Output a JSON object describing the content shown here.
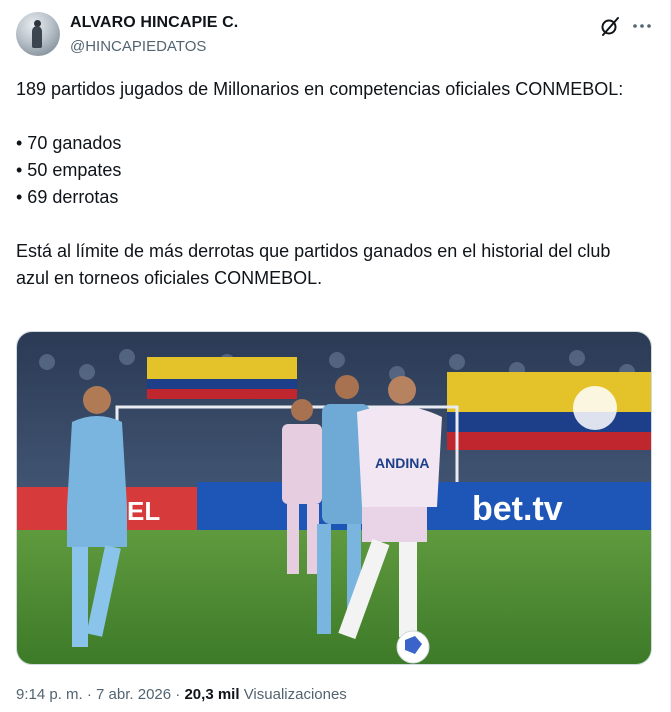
{
  "author": {
    "name": "ALVARO HINCAPIE C.",
    "handle": "@HINCAPIEDATOS"
  },
  "icons": {
    "grok": "grok-icon",
    "more": "more-icon"
  },
  "tweet": {
    "line1": "189 partidos jugados de Millonarios en competencias oficiales CONMEBOL:",
    "line2": "• 70 ganados\n• 50 empates\n• 69 derrotas",
    "line3": "Está al límite de más derrotas que partidos ganados en el historial del club azul en torneos oficiales CONMEBOL."
  },
  "image": {
    "shirt_text": "ANDINA",
    "board_text": "bet.tv",
    "board_text2": "EL"
  },
  "footer": {
    "time": "9:14 p. m.",
    "separator": "·",
    "date": "7 abr. 2026",
    "views_count": "20,3 mil",
    "views_label": "Visualizaciones"
  }
}
